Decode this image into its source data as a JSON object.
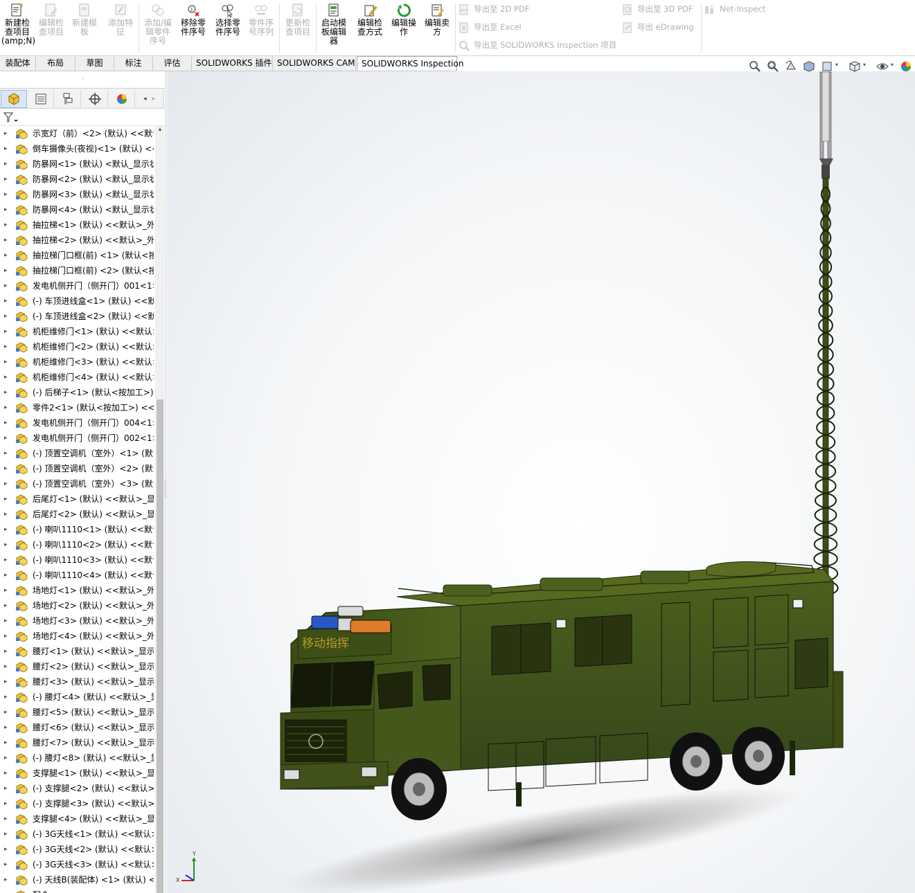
{
  "ribbon": {
    "buttons": [
      {
        "id": "new-inspection-project",
        "label": "新建检\n查项目\n(amp;N)",
        "enabled": true,
        "icon": "new-project-icon"
      },
      {
        "id": "edit-inspection-project",
        "label": "编辑检\n查项目",
        "enabled": false,
        "icon": "edit-project-icon"
      },
      {
        "id": "new-template",
        "label": "新建模\n板",
        "enabled": false,
        "icon": "new-template-icon"
      },
      {
        "id": "add-feature",
        "label": "添加特\n征",
        "enabled": false,
        "icon": "add-feature-icon"
      },
      {
        "id": "add-edit-part-balloon",
        "label": "添加/编\n辑零件\n序号",
        "enabled": false,
        "icon": "add-balloon-icon"
      },
      {
        "id": "remove-part-balloon",
        "label": "移除零\n件序号",
        "enabled": true,
        "icon": "remove-balloon-icon"
      },
      {
        "id": "select-part-balloon",
        "label": "选择零\n件序号",
        "enabled": true,
        "icon": "select-balloon-icon"
      },
      {
        "id": "balloon-sequence",
        "label": "零件序\n号序列",
        "enabled": false,
        "icon": "sequence-icon"
      },
      {
        "id": "update-inspection-project",
        "label": "更新检\n查项目",
        "enabled": false,
        "icon": "update-project-icon"
      },
      {
        "id": "launch-template-editor",
        "label": "启动模\n板编辑\n器",
        "enabled": true,
        "icon": "template-editor-icon"
      },
      {
        "id": "edit-inspection-method",
        "label": "编辑检\n查方式",
        "enabled": true,
        "icon": "edit-method-icon"
      },
      {
        "id": "edit-operation",
        "label": "编辑操\n作",
        "enabled": true,
        "icon": "edit-operation-icon"
      },
      {
        "id": "edit-vendor",
        "label": "编辑卖\n方",
        "enabled": true,
        "icon": "edit-vendor-icon"
      }
    ],
    "export": {
      "to_2d_pdf": "导出至 2D PDF",
      "to_excel": "导出至 Excel",
      "to_inspection_project": "导出至 SOLIDWORKS Inspection 项目",
      "to_3d_pdf": "导出至 3D PDF",
      "to_edrawing": "导出 eDrawing",
      "net_inspect": "Net-Inspect"
    }
  },
  "tabs": [
    {
      "label": "装配体",
      "active": false
    },
    {
      "label": "布局",
      "active": false
    },
    {
      "label": "草图",
      "active": false
    },
    {
      "label": "标注",
      "active": false
    },
    {
      "label": "评估",
      "active": false
    },
    {
      "label": "SOLIDWORKS 插件",
      "active": false
    },
    {
      "label": "SOLIDWORKS CAM",
      "active": false
    },
    {
      "label": "SOLIDWORKS Inspection",
      "active": true
    }
  ],
  "panel": {
    "grip": "◦",
    "tree_items": [
      "示宽灯（前）<2> (默认) <<默认",
      "倒车摄像头(夜视)<1> (默认) <<",
      "防暴网<1> (默认) <默认_显示状",
      "防暴网<2> (默认) <默认_显示状",
      "防暴网<3> (默认) <默认_显示状",
      "防暴网<4> (默认) <默认_显示状",
      "抽拉梯<1> (默认) <<默认>_外观",
      "抽拉梯<2> (默认) <<默认>_外观",
      "抽拉梯门口框(前) <1> (默认<按",
      "抽拉梯门口框(前) <2> (默认<按",
      "发电机侧开门（侧开门）001<1>",
      "(-) 车顶进线盒<1> (默认) <<默",
      "(-) 车顶进线盒<2> (默认) <<默",
      "机柜维修门<1> (默认) <<默认>",
      "机柜维修门<2> (默认) <<默认>",
      "机柜维修门<3> (默认) <<默认>",
      "机柜维修门<4> (默认) <<默认>",
      "(-) 后梯子<1> (默认<按加工>)",
      "零件2<1> (默认<按加工>) <<默",
      "发电机侧开门（侧开门）004<1>",
      "发电机侧开门（侧开门）002<1>",
      "(-) 顶置空调机（室外）<1> (默认",
      "(-) 顶置空调机（室外）<2> (默认",
      "(-) 顶置空调机（室外）<3> (默认",
      "后尾灯<1> (默认) <<默认>_显示",
      "后尾灯<2> (默认) <<默认>_显示",
      "(-) 喇叭1110<1> (默认) <<默认",
      "(-) 喇叭1110<2> (默认) <<默认",
      "(-) 喇叭1110<3> (默认) <<默认",
      "(-) 喇叭1110<4> (默认) <<默认",
      "场地灯<1> (默认) <<默认>_外观",
      "场地灯<2> (默认) <<默认>_外观",
      "场地灯<3> (默认) <<默认>_外观",
      "场地灯<4> (默认) <<默认>_外观",
      "腰灯<1> (默认) <<默认>_显示状",
      "腰灯<2> (默认) <<默认>_显示状",
      "腰灯<3> (默认) <<默认>_显示状",
      "(-) 腰灯<4> (默认) <<默认>_显",
      "腰灯<5> (默认) <<默认>_显示状",
      "腰灯<6> (默认) <<默认>_显示状",
      "腰灯<7> (默认) <<默认>_显示状",
      "(-) 腰灯<8> (默认) <<默认>_显",
      "支撑腿<1> (默认) <<默认>_显示",
      "(-) 支撑腿<2> (默认) <<默认>_",
      "(-) 支撑腿<3> (默认) <<默认>_",
      "支撑腿<4> (默认) <<默认>_显示",
      "(-) 3G天线<1> (默认) <<默认>_",
      "(-) 3G天线<2> (默认) <<默认>_",
      "(-) 3G天线<3> (默认) <<默认>_",
      "(-) 天线B(装配体) <1> (默认) <",
      "配合"
    ]
  },
  "viewport": {
    "truck_sign": "移动指挥",
    "triad_label_y": "Y",
    "triad_label_x": "X"
  },
  "colors": {
    "truck_body": "#3f5218",
    "truck_dark": "#1f2a0c",
    "accent_blue": "#2a57c8",
    "accent_orange": "#e07b2a",
    "active_tab_border": "#a8a8a8"
  }
}
